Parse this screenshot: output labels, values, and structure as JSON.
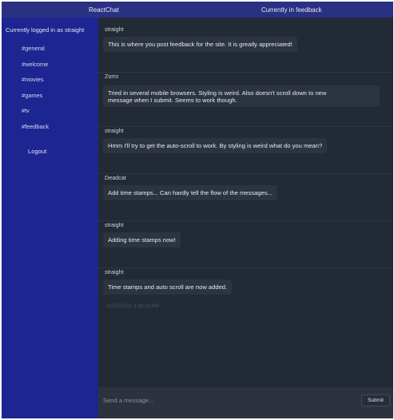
{
  "header": {
    "brand": "ReactChat",
    "channel_title": "Currently in feedback"
  },
  "sidebar": {
    "status": "Currently logged in as straight",
    "channels": [
      "#general",
      "#welcome",
      "#movies",
      "#games",
      "#tv",
      "#feedback"
    ],
    "logout_label": "Logout"
  },
  "messages": [
    {
      "author": "straight",
      "text": "This is where you post feedback for the site. It is greatly appreciated!"
    },
    {
      "author": "Zorro",
      "text_line1": "Tried in several mobile browsers. Styling is weird. Also doesn't scroll down to new",
      "text_line2": "message when I submit. Seems to work though."
    },
    {
      "author": "straight",
      "text": "Hmm I'll try to get the auto-scroll to work. By styling is weird what do you mean?"
    },
    {
      "author": "Deadcat",
      "text": "Add time stamps... Can hardly tell the flow of the messages..."
    },
    {
      "author": "straight",
      "text": "Adding time stamps now!"
    },
    {
      "author": "straight",
      "text": "Time stamps and auto scroll are now added.",
      "timestamp": "02/15/2019, 1:38:33 PM"
    }
  ],
  "composer": {
    "placeholder": "Send a message...",
    "submit_label": "Submit"
  },
  "colors": {
    "header": "#2a3183",
    "sidebar": "#1d2592",
    "chat_background": "#222a35",
    "bubble": "#2c3440",
    "composer": "#2c333e"
  }
}
